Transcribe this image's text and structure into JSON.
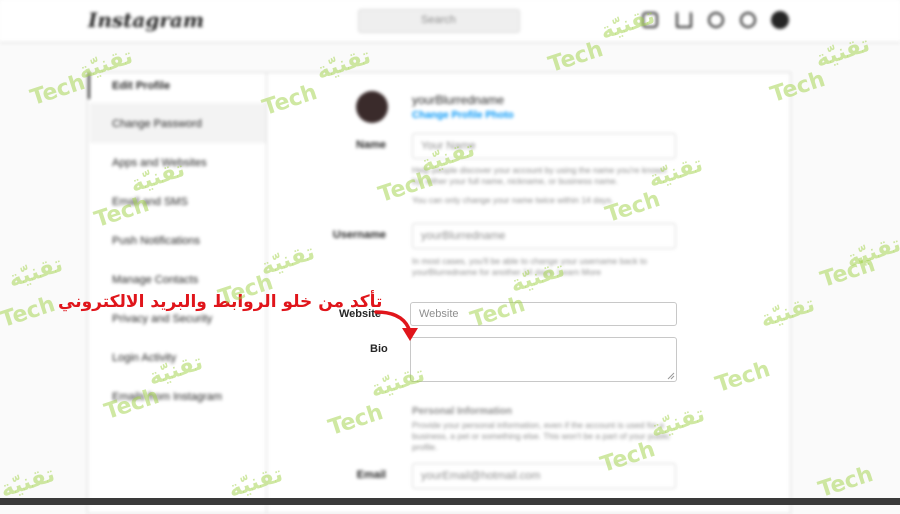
{
  "topbar": {
    "logo": "Instagram",
    "search_placeholder": "Search"
  },
  "sidebar": {
    "items": [
      {
        "label": "Edit Profile"
      },
      {
        "label": "Change Password"
      },
      {
        "label": "Apps and Websites"
      },
      {
        "label": "Email and SMS"
      },
      {
        "label": "Push Notifications"
      },
      {
        "label": "Manage Contacts"
      },
      {
        "label": "Privacy and Security"
      },
      {
        "label": "Login Activity"
      },
      {
        "label": "Emails from Instagram"
      }
    ]
  },
  "profile": {
    "username": "yourBlurredname",
    "change_photo": "Change Profile Photo"
  },
  "form": {
    "name_label": "Name",
    "name_value": "Your Name",
    "name_help": "Help people discover your account by using the name you're known by: either your full name, nickname, or business name.",
    "name_help2": "You can only change your name twice within 14 days.",
    "username_label": "Username",
    "username_value": "yourBlurredname",
    "username_help": "In most cases, you'll be able to change your username back to yourBlurredname for another 14 days. Learn More",
    "website_label": "Website",
    "website_placeholder": "Website",
    "bio_label": "Bio",
    "bio_value": "",
    "personal_title": "Personal Information",
    "personal_help": "Provide your personal information, even if the account is used for a business, a pet or something else. This won't be a part of your public profile.",
    "email_label": "Email",
    "email_value": "yourEmail@hotmail.com"
  },
  "annotation": {
    "text": "تأكد من خلو الروابط والبريد الالكتروني"
  },
  "watermark": {
    "latin": "Tech",
    "arabic": "تقنيّة",
    "color": "#a0d246"
  },
  "colors": {
    "link": "#0095f6",
    "annotation": "#e0151b"
  }
}
